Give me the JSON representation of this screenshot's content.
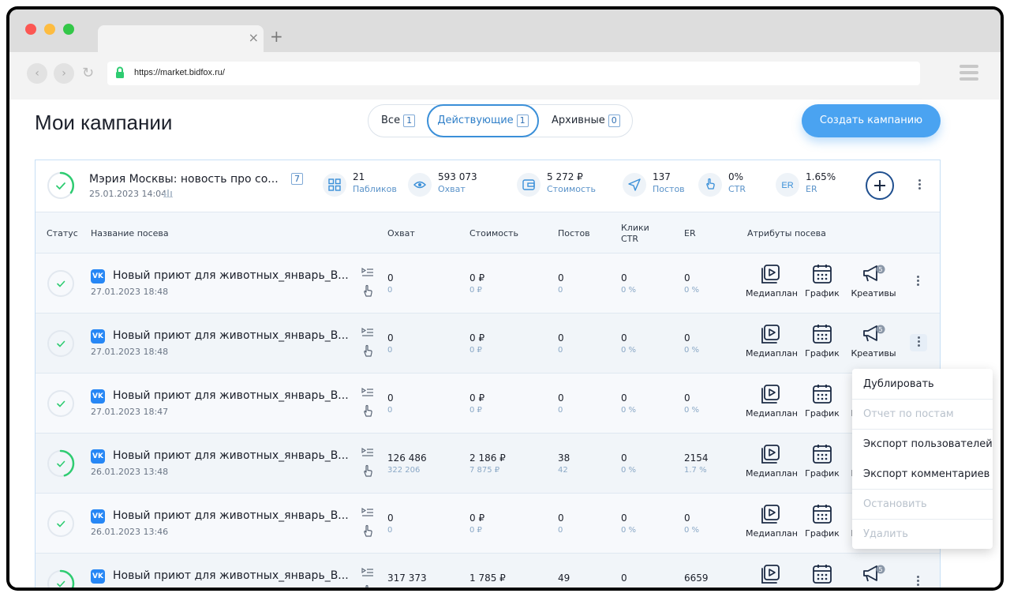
{
  "browser": {
    "url": "https://market.bidfox.ru/",
    "tab_close": "×",
    "tab_new": "+",
    "back": "‹",
    "forward": "›",
    "reload": "↻"
  },
  "page": {
    "title": "Мои кампании",
    "create_button": "Создать кампанию"
  },
  "filters": [
    {
      "label": "Все",
      "count": "1"
    },
    {
      "label": "Действующие",
      "count": "1"
    },
    {
      "label": "Архивные",
      "count": "0"
    }
  ],
  "campaign": {
    "title": "Мэрия Москвы: новость про со...",
    "badge": "7",
    "date": "25.01.2023 14:04",
    "stats": [
      {
        "value": "21",
        "label": "Пабликов",
        "icon": "grid-icon"
      },
      {
        "value": "593 073",
        "label": "Охват",
        "icon": "eye-icon"
      },
      {
        "value": "5 272 ₽",
        "label": "Стоимость",
        "icon": "wallet-icon"
      },
      {
        "value": "137",
        "label": "Постов",
        "icon": "send-icon"
      },
      {
        "value": "0%",
        "label": "CTR",
        "icon": "pointer-icon"
      },
      {
        "value": "1.65%",
        "label": "ER",
        "icon": "er-icon",
        "icon_text": "ER"
      }
    ]
  },
  "columns": {
    "status": "Статус",
    "name": "Название посева",
    "reach": "Охват",
    "cost": "Стоимость",
    "posts": "Постов",
    "clicks": "Клики",
    "ctr": "CTR",
    "er": "ER",
    "attributes": "Атрибуты посева"
  },
  "vk_label": "VK",
  "attributes": {
    "mediaplan": "Медиаплан",
    "schedule": "График",
    "creatives": "Креативы",
    "creative_badge": "5"
  },
  "rows": [
    {
      "title": "Новый приют для животных_январь_В...",
      "date": "27.01.2023 18:48",
      "reach": "0",
      "reach_sub": "0",
      "cost": "0 ₽",
      "cost_sub": "0 ₽",
      "posts": "0",
      "posts_sub": "0",
      "clicks": "0",
      "clicks_sub": "0 %",
      "er": "0",
      "er_sub": "0 %",
      "progress": 0
    },
    {
      "title": "Новый приют для животных_январь_В...",
      "date": "27.01.2023 18:48",
      "reach": "0",
      "reach_sub": "0",
      "cost": "0 ₽",
      "cost_sub": "0 ₽",
      "posts": "0",
      "posts_sub": "0",
      "clicks": "0",
      "clicks_sub": "0 %",
      "er": "0",
      "er_sub": "0 %",
      "progress": 0
    },
    {
      "title": "Новый приют для животных_январь_В...",
      "date": "27.01.2023 18:47",
      "reach": "0",
      "reach_sub": "0",
      "cost": "0 ₽",
      "cost_sub": "0 ₽",
      "posts": "0",
      "posts_sub": "0",
      "clicks": "0",
      "clicks_sub": "0 %",
      "er": "0",
      "er_sub": "0 %",
      "progress": 0
    },
    {
      "title": "Новый приют для животных_январь_В...",
      "date": "26.01.2023 13:48",
      "reach": "126 486",
      "reach_sub": "322 206",
      "cost": "2 186 ₽",
      "cost_sub": "7 875 ₽",
      "posts": "38",
      "posts_sub": "42",
      "clicks": "0",
      "clicks_sub": "0 %",
      "er": "2154",
      "er_sub": "1.7 %",
      "progress": 0.45
    },
    {
      "title": "Новый приют для животных_январь_В...",
      "date": "26.01.2023 13:46",
      "reach": "0",
      "reach_sub": "0",
      "cost": "0 ₽",
      "cost_sub": "0 ₽",
      "posts": "0",
      "posts_sub": "0",
      "clicks": "0",
      "clicks_sub": "0 %",
      "er": "0",
      "er_sub": "0 %",
      "progress": 0
    },
    {
      "title": "Новый приют для животных_январь_В...",
      "date": "",
      "reach": "317 373",
      "reach_sub": "",
      "cost": "1 785 ₽",
      "cost_sub": "",
      "posts": "49",
      "posts_sub": "",
      "clicks": "0",
      "clicks_sub": "",
      "er": "6659",
      "er_sub": "",
      "progress": 0.45
    }
  ],
  "dropdown": [
    {
      "label": "Дублировать",
      "disabled": false
    },
    {
      "label": "Отчет по постам",
      "disabled": true
    },
    {
      "label": "Экспорт пользователей",
      "disabled": false
    },
    {
      "label": "Экспорт комментариев",
      "disabled": false
    },
    {
      "label": "Остановить",
      "disabled": true
    },
    {
      "label": "Удалить",
      "disabled": true
    }
  ],
  "colors": {
    "accent": "#4aa3f1",
    "status_ok": "#2ecc71",
    "vk": "#2787f5"
  }
}
